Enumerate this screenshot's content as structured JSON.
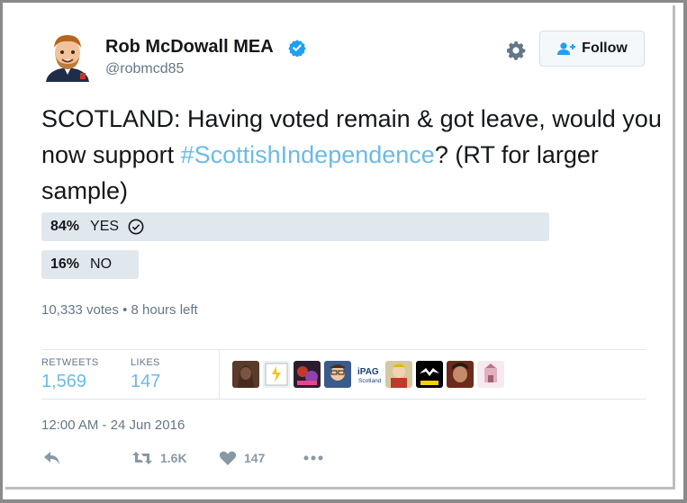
{
  "user": {
    "name": "Rob McDowall MEA",
    "handle": "@robmcd85",
    "verified": true
  },
  "follow_label": "Follow",
  "tweet": {
    "text_before": "SCOTLAND: Having voted remain & got leave, would you now support ",
    "hashtag": "#ScottishIndependence",
    "text_after": "? (RT for larger sample)"
  },
  "poll": {
    "options": [
      {
        "percent": "84%",
        "label": "YES",
        "value": 84,
        "winner": true
      },
      {
        "percent": "16%",
        "label": "NO",
        "value": 16,
        "winner": false
      }
    ],
    "votes": "10,333 votes",
    "separator": "•",
    "time_left": "8 hours left"
  },
  "stats": {
    "retweets_label": "RETWEETS",
    "retweets": "1,569",
    "likes_label": "LIKES",
    "likes": "147",
    "liker_avatars": [
      "avatar-1",
      "avatar-2",
      "avatar-3",
      "avatar-4",
      "avatar-5-ipag-scotland",
      "avatar-6",
      "avatar-7-snp",
      "avatar-8",
      "avatar-9"
    ],
    "ipag_text": "iPAG",
    "ipag_sub": "Scotland"
  },
  "timestamp": "12:00 AM - 24 Jun 2016",
  "actions": {
    "retweet_count": "1.6K",
    "like_count": "147"
  },
  "colors": {
    "link": "#6bbbe8",
    "verified": "#1da1f2",
    "poll_bar": "#e1e8ed",
    "muted": "#657786"
  }
}
